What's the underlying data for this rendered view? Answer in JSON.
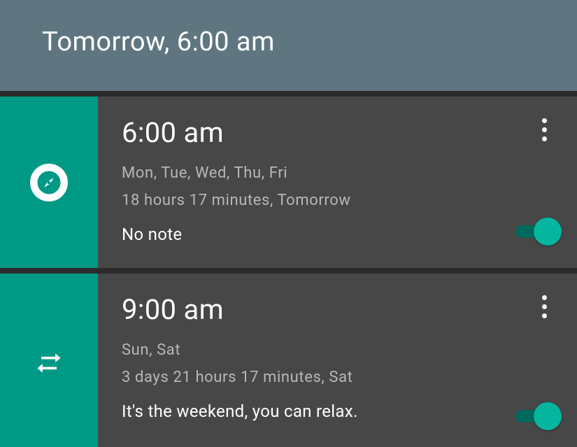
{
  "header": {
    "title": "Tomorrow, 6:00 am"
  },
  "alarms": [
    {
      "icon": "compass-icon",
      "time": "6:00 am",
      "days": "Mon, Tue, Wed, Thu, Fri",
      "remaining": "18 hours 17 minutes, Tomorrow",
      "note": "No note",
      "enabled": true
    },
    {
      "icon": "repeat-icon",
      "time": "9:00 am",
      "days": "Sun, Sat",
      "remaining": "3 days 21 hours 17 minutes, Sat",
      "note": "It's the weekend, you can relax.",
      "enabled": true
    }
  ],
  "colors": {
    "accent": "#009985",
    "header_bg": "#5f7681",
    "card_bg": "#474747",
    "thumb": "#05b59f"
  }
}
